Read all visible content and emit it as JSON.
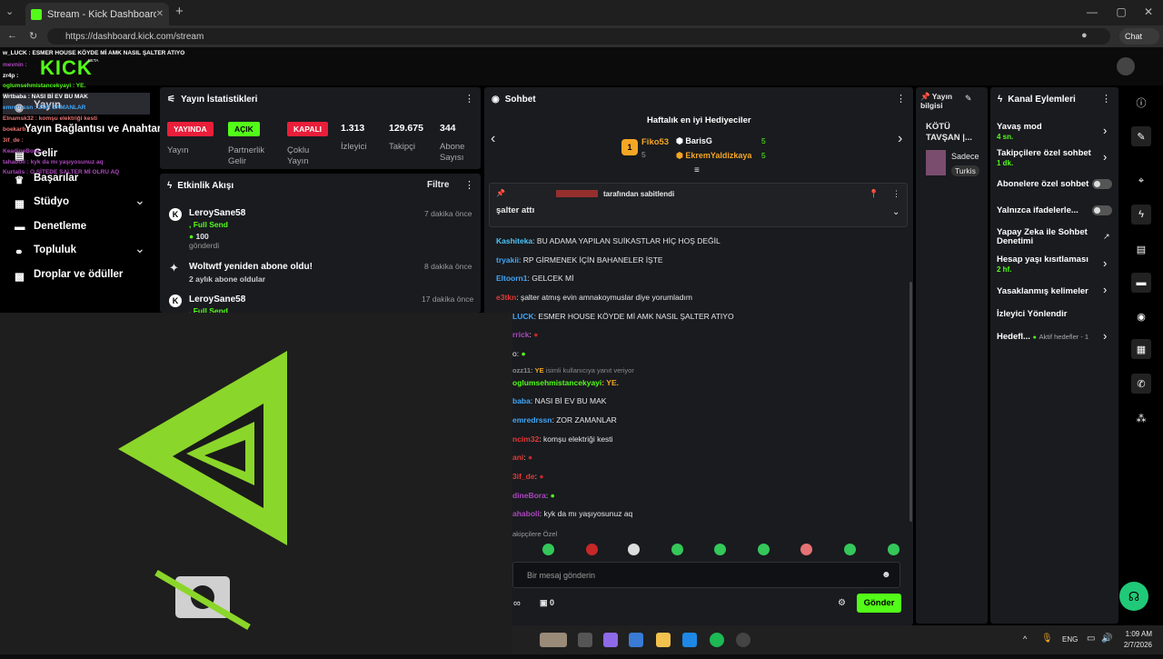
{
  "browser": {
    "tab_title": "Stream - Kick Dashboard",
    "new_tab": "+",
    "url": "https://dashboard.kick.com/stream",
    "chat_button": "Chat"
  },
  "brand": {
    "logo": "KICK",
    "beta": "BETA"
  },
  "sidebar": {
    "items": [
      {
        "label": "Yayın",
        "icon": "video-icon"
      },
      {
        "label": "Yayın Bağlantısı ve Anahtarı",
        "icon": "key-icon"
      },
      {
        "label": "Gelir",
        "icon": "money-icon"
      },
      {
        "label": "Başarılar",
        "icon": "trophy-icon"
      },
      {
        "label": "Stüdyo",
        "icon": "studio-icon"
      },
      {
        "label": "Denetleme",
        "icon": "moderation-icon"
      },
      {
        "label": "Topluluk",
        "icon": "community-icon"
      },
      {
        "label": "Droplar ve ödüller",
        "icon": "gift-icon"
      }
    ]
  },
  "stats": {
    "title": "Yayın İstatistikleri",
    "items": [
      {
        "badge": "YAYINDA",
        "label": "Yayın"
      },
      {
        "badge": "AÇIK",
        "label": "Partnerlik Gelir"
      },
      {
        "badge": "KAPALI",
        "label": "Çoklu Yayın"
      },
      {
        "value": "1.313",
        "label": "İzleyici"
      },
      {
        "value": "129.675",
        "label": "Takipçi"
      },
      {
        "value": "344",
        "label": "Abone Sayısı"
      }
    ]
  },
  "activity": {
    "title": "Etkinlik Akışı",
    "filter": "Filtre",
    "events": [
      {
        "name": "LeroySane58",
        "time": "7 dakika önce",
        "line1": ", Full Send",
        "amount": "100",
        "line2": "gönderdi"
      },
      {
        "name": "Woltwtf yeniden abone oldu!",
        "time": "8 dakika önce",
        "line1": "2 aylık abone oldular"
      },
      {
        "name": "LeroySane58",
        "time": "17 dakika önce",
        "line1": ", Full Send"
      }
    ]
  },
  "chat": {
    "title": "Sohbet",
    "gifters_title": "Haftalık en iyi Hediyeciler",
    "gifters": [
      {
        "rank": "1",
        "name": "Fiko53",
        "count": "5"
      },
      {
        "name": "BarisG",
        "count": "5"
      },
      {
        "name": "EkremYaldizkaya",
        "count": "5"
      }
    ],
    "pinned_by": "tarafından sabitlendi",
    "pinned_msg": "şalter attı",
    "messages": [
      {
        "user": "Kashiteka",
        "text": ": BU ADAMA YAPILAN SUİKASTLAR HİÇ HOŞ DEĞİL",
        "color": "#4fc3f7"
      },
      {
        "user": "tryakii",
        "text": ": RP GİRMENEK İÇİN BAHANELER İŞTE",
        "color": "#42a5f5"
      },
      {
        "user": "Eltoorn1",
        "text": ": GELCEK Mİ",
        "color": "#42a5f5"
      },
      {
        "user": "e3tkn",
        "text": ": şalter atmış evin amnakoymuslar diye yorumladım",
        "color": "#e53935"
      },
      {
        "user": "LUCK",
        "text": ": ESMER HOUSE KÖYDE Mİ AMK NASIL ŞALTER ATIYO",
        "color": "#42a5f5"
      },
      {
        "user": "rrick",
        "text": ":",
        "color": "#ab47bc"
      },
      {
        "user": "",
        "text": "o:",
        "color": "#fff"
      },
      {
        "user": "ozz11:",
        "text": "isimli kullanıcıya yanıt veriyor",
        "color": "#888"
      },
      {
        "user": "oglumsehmistancekyayi",
        "text": ": YE.",
        "color": "#53fc18"
      },
      {
        "user": "baba",
        "text": ": NASI Bİ EV BU MAK",
        "color": "#42a5f5"
      },
      {
        "user": "emredrssn",
        "text": ": ZOR ZAMANLAR",
        "color": "#42a5f5"
      },
      {
        "user": "ncim32",
        "text": ": komşu elektriği kesti",
        "color": "#e53935"
      },
      {
        "user": "ani",
        "text": ":",
        "color": "#e53935"
      },
      {
        "user": "3if_de",
        "text": ":",
        "color": "#e53935"
      },
      {
        "user": "dineBora",
        "text": ":",
        "color": "#ab47bc"
      },
      {
        "user": "ahaboli",
        "text": ": kyk da mı yaşıyosunuz aq",
        "color": "#ab47bc"
      }
    ],
    "subs_only": "akipçilere Özel",
    "input_placeholder": "Bir mesaj gönderin",
    "count": "0",
    "send": "Gönder"
  },
  "stream_info": {
    "title": "Yayın bilgisi",
    "stream_title": "KÖTÜ TAVŞAN |...",
    "category": "Sadece",
    "language": "Turkis"
  },
  "channel": {
    "title": "Kanal Eylemleri",
    "actions": [
      {
        "label": "Yavaş mod",
        "sub": "4 sn."
      },
      {
        "label": "Takipçilere özel sohbet",
        "sub": "1 dk."
      },
      {
        "label": "Abonelere özel sohbet"
      },
      {
        "label": "Yalnızca ifadelerle..."
      },
      {
        "label": "Yapay Zeka ile Sohbet Denetimi"
      },
      {
        "label": "Hesap yaşı kısıtlaması",
        "sub": "2 hf."
      },
      {
        "label": "Yasaklanmış kelimeler"
      },
      {
        "label": "İzleyici Yönlendir"
      },
      {
        "label": "Hedefl...",
        "sub": "Aktif hedefler - 1"
      }
    ]
  },
  "overlay_chat": [
    "w_LUCK : ESMER HOUSE KÖYDE Mİ AMK NASIL ŞALTER ATIYO",
    "mevnin :",
    "zr4p :",
    "oglumsehmistancekyayi : YE.",
    "Wrtbaba : NASI Bİ EV BU MAK",
    "emredrssn : ZOR ZAMANLAR",
    "Elnamsk32 : komşu elektriği kesti",
    "boekarb :",
    "3if_de :",
    "KeadineBora :",
    "tahaboli : kyk da mı yaşıyosunuz aq",
    "Kurtalis : O SİTEDE SALTER Mİ OLRU AQ"
  ],
  "taskbar": {
    "lang": "ENG",
    "time": "1:09 AM",
    "date": "2/7/2026"
  },
  "colors": {
    "accent": "#53fc18",
    "panel": "#191b1f",
    "live": "#e91e3a"
  }
}
